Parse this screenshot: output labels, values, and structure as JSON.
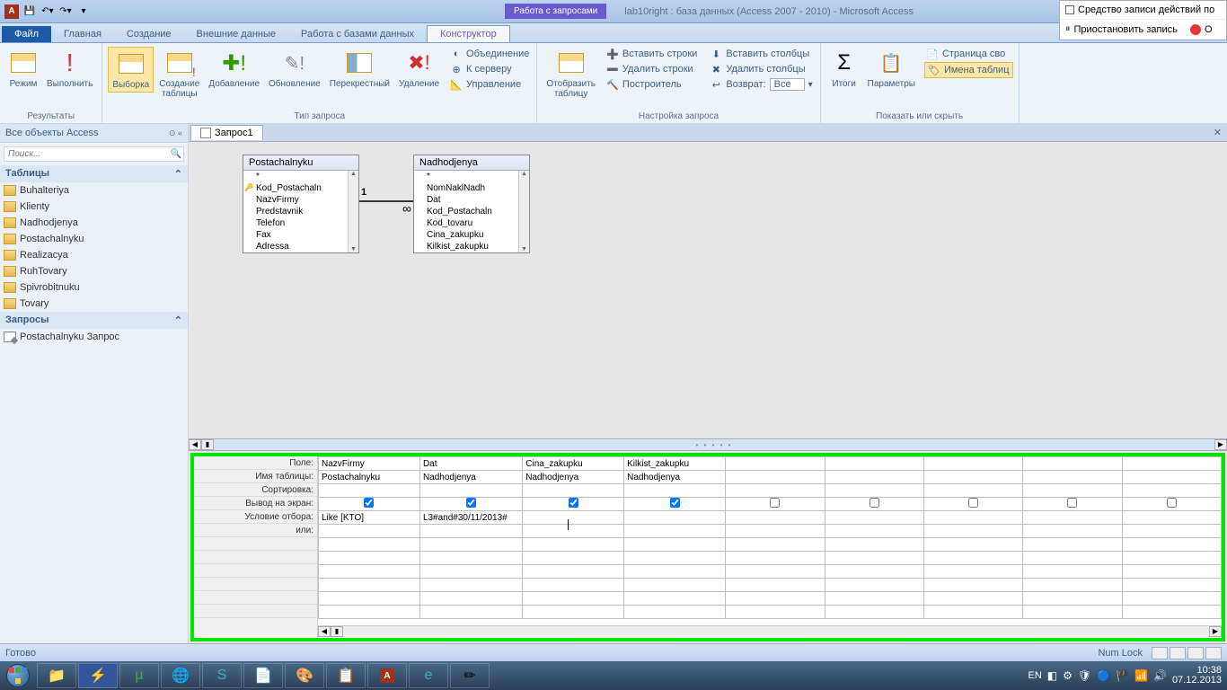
{
  "titlebar": {
    "app_icon": "A",
    "contextual_tab": "Работа с запросами",
    "doc_title": "lab10right : база данных (Access 2007 - 2010) - Microsoft Access"
  },
  "macro_widget": {
    "line1": "Средство записи действий по",
    "line2": "Приостановить запись",
    "line3_suffix": "О"
  },
  "tabs": {
    "file": "Файл",
    "home": "Главная",
    "create": "Создание",
    "external": "Внешние данные",
    "dbtools": "Работа с базами данных",
    "design": "Конструктор"
  },
  "ribbon": {
    "results": {
      "view": "Режим",
      "run": "Выполнить",
      "label": "Результаты"
    },
    "querytype": {
      "select": "Выборка",
      "maketable": "Создание\nтаблицы",
      "append": "Добавление",
      "update": "Обновление",
      "crosstab": "Перекрестный",
      "delete": "Удаление",
      "union": "Объединение",
      "passthrough": "К серверу",
      "datadef": "Управление",
      "label": "Тип запроса"
    },
    "setup": {
      "showtable": "Отобразить\nтаблицу",
      "insertrows": "Вставить строки",
      "deleterows": "Удалить строки",
      "builder": "Построитель",
      "insertcols": "Вставить столбцы",
      "deletecols": "Удалить столбцы",
      "return_label": "Возврат:",
      "return_value": "Все",
      "label": "Настройка запроса"
    },
    "showhide": {
      "totals": "Итоги",
      "params": "Параметры",
      "propsheet": "Страница сво",
      "tablenames": "Имена таблиц",
      "label": "Показать или скрыть"
    }
  },
  "navpane": {
    "title": "Все объекты Access",
    "search_placeholder": "Поиск...",
    "tables_header": "Таблицы",
    "tables": [
      "Buhalteriya",
      "Klienty",
      "Nadhodjenya",
      "Postachalnyku",
      "Realizacya",
      "RuhTovary",
      "Spivrobitnuku",
      "Tovary"
    ],
    "queries_header": "Запросы",
    "queries": [
      "Postachalnyku Запрос"
    ]
  },
  "doctab": "Запрос1",
  "tables_on_canvas": {
    "t1": {
      "title": "Postachalnyku",
      "fields": [
        "*",
        "Kod_Postachaln",
        "NazvFirmy",
        "Predstavnik",
        "Telefon",
        "Fax",
        "Adressa"
      ],
      "key_index": 1
    },
    "t2": {
      "title": "Nadhodjenya",
      "fields": [
        "*",
        "NomNaklNadh",
        "Dat",
        "Kod_Postachaln",
        "Kod_tovaru",
        "Cina_zakupku",
        "Kilkist_zakupku"
      ]
    }
  },
  "relation": {
    "left_label": "1",
    "right_label": "∞"
  },
  "grid": {
    "rowlabels": [
      "Поле:",
      "Имя таблицы:",
      "Сортировка:",
      "Вывод на экран:",
      "Условие отбора:",
      "или:"
    ],
    "cols": [
      {
        "field": "NazvFirmy",
        "table": "Postachalnyku",
        "show": true,
        "criteria": "Like [KTO]"
      },
      {
        "field": "Dat",
        "table": "Nadhodjenya",
        "show": true,
        "criteria": "L3#and#30/11/2013#"
      },
      {
        "field": "Cina_zakupku",
        "table": "Nadhodjenya",
        "show": true,
        "criteria": ""
      },
      {
        "field": "Kilkist_zakupku",
        "table": "Nadhodjenya",
        "show": true,
        "criteria": ""
      },
      {
        "field": "",
        "table": "",
        "show": false,
        "criteria": ""
      },
      {
        "field": "",
        "table": "",
        "show": false,
        "criteria": ""
      },
      {
        "field": "",
        "table": "",
        "show": false,
        "criteria": ""
      },
      {
        "field": "",
        "table": "",
        "show": false,
        "criteria": ""
      },
      {
        "field": "",
        "table": "",
        "show": false,
        "criteria": ""
      }
    ]
  },
  "statusbar": {
    "ready": "Готово",
    "numlock": "Num Lock"
  },
  "taskbar": {
    "lang": "EN",
    "time": "10:38",
    "date": "07.12.2013"
  }
}
